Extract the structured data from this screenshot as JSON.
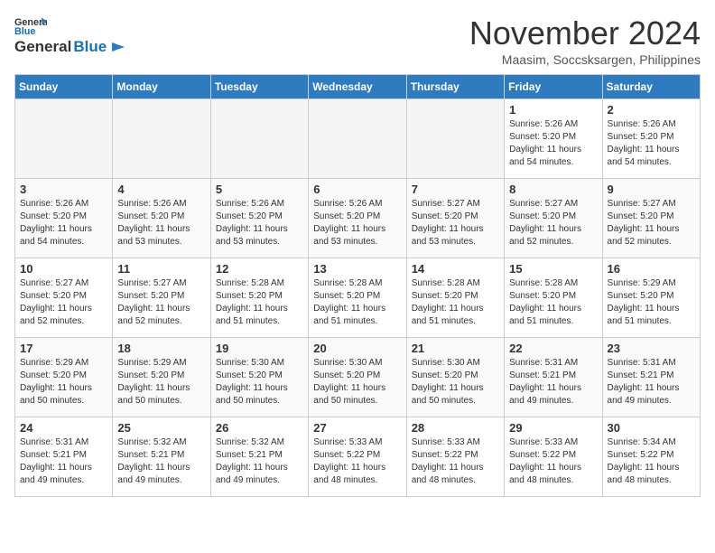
{
  "header": {
    "logo_line1": "General",
    "logo_line2": "Blue",
    "month_title": "November 2024",
    "location": "Maasim, Soccsksargen, Philippines"
  },
  "weekdays": [
    "Sunday",
    "Monday",
    "Tuesday",
    "Wednesday",
    "Thursday",
    "Friday",
    "Saturday"
  ],
  "weeks": [
    [
      {
        "day": "",
        "info": ""
      },
      {
        "day": "",
        "info": ""
      },
      {
        "day": "",
        "info": ""
      },
      {
        "day": "",
        "info": ""
      },
      {
        "day": "",
        "info": ""
      },
      {
        "day": "1",
        "info": "Sunrise: 5:26 AM\nSunset: 5:20 PM\nDaylight: 11 hours and 54 minutes."
      },
      {
        "day": "2",
        "info": "Sunrise: 5:26 AM\nSunset: 5:20 PM\nDaylight: 11 hours and 54 minutes."
      }
    ],
    [
      {
        "day": "3",
        "info": "Sunrise: 5:26 AM\nSunset: 5:20 PM\nDaylight: 11 hours and 54 minutes."
      },
      {
        "day": "4",
        "info": "Sunrise: 5:26 AM\nSunset: 5:20 PM\nDaylight: 11 hours and 53 minutes."
      },
      {
        "day": "5",
        "info": "Sunrise: 5:26 AM\nSunset: 5:20 PM\nDaylight: 11 hours and 53 minutes."
      },
      {
        "day": "6",
        "info": "Sunrise: 5:26 AM\nSunset: 5:20 PM\nDaylight: 11 hours and 53 minutes."
      },
      {
        "day": "7",
        "info": "Sunrise: 5:27 AM\nSunset: 5:20 PM\nDaylight: 11 hours and 53 minutes."
      },
      {
        "day": "8",
        "info": "Sunrise: 5:27 AM\nSunset: 5:20 PM\nDaylight: 11 hours and 52 minutes."
      },
      {
        "day": "9",
        "info": "Sunrise: 5:27 AM\nSunset: 5:20 PM\nDaylight: 11 hours and 52 minutes."
      }
    ],
    [
      {
        "day": "10",
        "info": "Sunrise: 5:27 AM\nSunset: 5:20 PM\nDaylight: 11 hours and 52 minutes."
      },
      {
        "day": "11",
        "info": "Sunrise: 5:27 AM\nSunset: 5:20 PM\nDaylight: 11 hours and 52 minutes."
      },
      {
        "day": "12",
        "info": "Sunrise: 5:28 AM\nSunset: 5:20 PM\nDaylight: 11 hours and 51 minutes."
      },
      {
        "day": "13",
        "info": "Sunrise: 5:28 AM\nSunset: 5:20 PM\nDaylight: 11 hours and 51 minutes."
      },
      {
        "day": "14",
        "info": "Sunrise: 5:28 AM\nSunset: 5:20 PM\nDaylight: 11 hours and 51 minutes."
      },
      {
        "day": "15",
        "info": "Sunrise: 5:28 AM\nSunset: 5:20 PM\nDaylight: 11 hours and 51 minutes."
      },
      {
        "day": "16",
        "info": "Sunrise: 5:29 AM\nSunset: 5:20 PM\nDaylight: 11 hours and 51 minutes."
      }
    ],
    [
      {
        "day": "17",
        "info": "Sunrise: 5:29 AM\nSunset: 5:20 PM\nDaylight: 11 hours and 50 minutes."
      },
      {
        "day": "18",
        "info": "Sunrise: 5:29 AM\nSunset: 5:20 PM\nDaylight: 11 hours and 50 minutes."
      },
      {
        "day": "19",
        "info": "Sunrise: 5:30 AM\nSunset: 5:20 PM\nDaylight: 11 hours and 50 minutes."
      },
      {
        "day": "20",
        "info": "Sunrise: 5:30 AM\nSunset: 5:20 PM\nDaylight: 11 hours and 50 minutes."
      },
      {
        "day": "21",
        "info": "Sunrise: 5:30 AM\nSunset: 5:20 PM\nDaylight: 11 hours and 50 minutes."
      },
      {
        "day": "22",
        "info": "Sunrise: 5:31 AM\nSunset: 5:21 PM\nDaylight: 11 hours and 49 minutes."
      },
      {
        "day": "23",
        "info": "Sunrise: 5:31 AM\nSunset: 5:21 PM\nDaylight: 11 hours and 49 minutes."
      }
    ],
    [
      {
        "day": "24",
        "info": "Sunrise: 5:31 AM\nSunset: 5:21 PM\nDaylight: 11 hours and 49 minutes."
      },
      {
        "day": "25",
        "info": "Sunrise: 5:32 AM\nSunset: 5:21 PM\nDaylight: 11 hours and 49 minutes."
      },
      {
        "day": "26",
        "info": "Sunrise: 5:32 AM\nSunset: 5:21 PM\nDaylight: 11 hours and 49 minutes."
      },
      {
        "day": "27",
        "info": "Sunrise: 5:33 AM\nSunset: 5:22 PM\nDaylight: 11 hours and 48 minutes."
      },
      {
        "day": "28",
        "info": "Sunrise: 5:33 AM\nSunset: 5:22 PM\nDaylight: 11 hours and 48 minutes."
      },
      {
        "day": "29",
        "info": "Sunrise: 5:33 AM\nSunset: 5:22 PM\nDaylight: 11 hours and 48 minutes."
      },
      {
        "day": "30",
        "info": "Sunrise: 5:34 AM\nSunset: 5:22 PM\nDaylight: 11 hours and 48 minutes."
      }
    ]
  ]
}
